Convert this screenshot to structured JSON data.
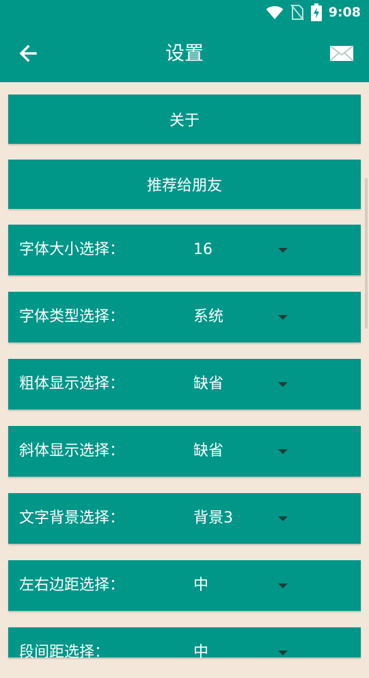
{
  "status_bar": {
    "time": "9:08",
    "icons": [
      "wifi-icon",
      "no-sim-icon",
      "battery-charging-icon"
    ]
  },
  "app_bar": {
    "title": "设置",
    "back_icon": "arrow-left-icon",
    "mail_icon": "mail-icon"
  },
  "buttons": [
    {
      "label": "关于"
    },
    {
      "label": "推荐给朋友"
    }
  ],
  "settings": [
    {
      "label": "字体大小选择：",
      "value": "16"
    },
    {
      "label": "字体类型选择：",
      "value": "系统"
    },
    {
      "label": "粗体显示选择：",
      "value": "缺省"
    },
    {
      "label": "斜体显示选择：",
      "value": "缺省"
    },
    {
      "label": "文字背景选择：",
      "value": "背景3"
    },
    {
      "label": "左右边距选择：",
      "value": "中"
    },
    {
      "label": "段间距选择：",
      "value": "中"
    }
  ],
  "colors": {
    "primary": "#009688",
    "background": "#f3e7da",
    "text": "#ffffff"
  }
}
